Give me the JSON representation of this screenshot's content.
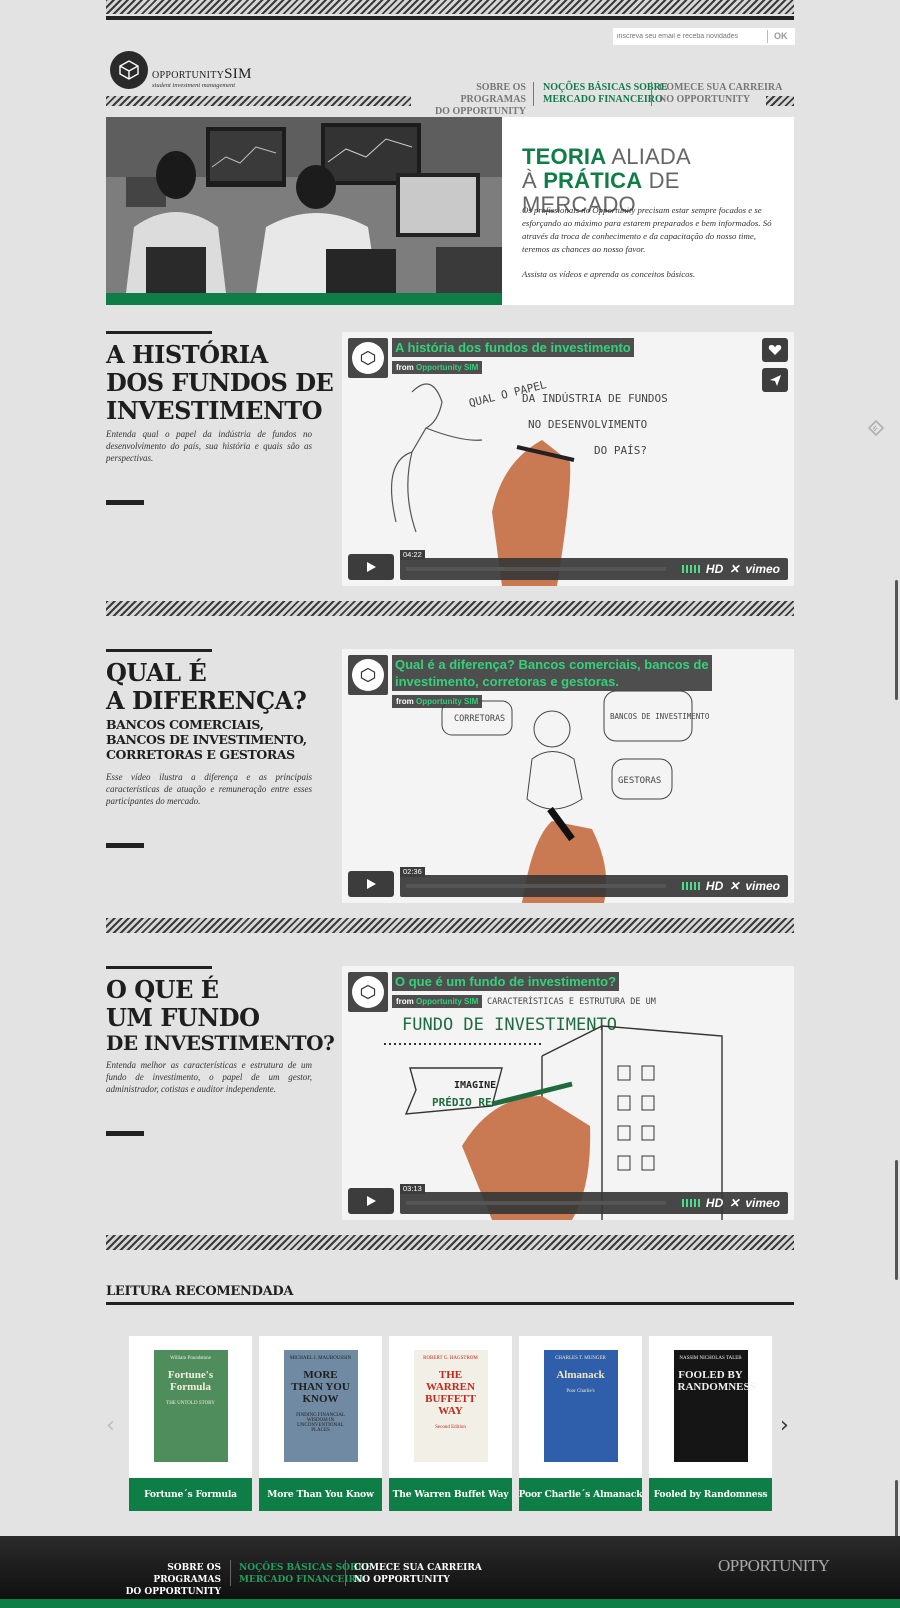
{
  "newsletter": {
    "placeholder": "inscreva seu email e receba novidades",
    "button": "OK"
  },
  "logo": {
    "name_prefix": "OPPORTUNITY",
    "name_suffix": "SIM",
    "tagline": "student investment management"
  },
  "nav": [
    {
      "line1": "SOBRE OS PROGRAMAS",
      "line2": "DO OPPORTUNITY"
    },
    {
      "line1": "NOÇÕES BÁSICAS SOBRE",
      "line2": "MERCADO FINANCEIRO"
    },
    {
      "line1": "COMECE SUA CARREIRA",
      "line2": "NO OPPORTUNITY"
    }
  ],
  "hero": {
    "title_a_bold": "TEORIA",
    "title_a_light": " ALIADA",
    "title_b_light": "À ",
    "title_b_bold": "PRÁTICA",
    "title_b_end": " DE MERCADO",
    "text": "Os profissionais no Opportunity precisam estar sempre focados e se esforçando ao máximo para estarem preparados e bem informados. Só através da troca de conhecimento e da capacitação do nosso time, teremos as chances ao nosso favor.",
    "text2": "Assista os vídeos e aprenda os conceitos básicos."
  },
  "sections": [
    {
      "title1": "A HISTÓRIA",
      "title2": "DOS FUNDOS DE",
      "title3": "INVESTIMENTO",
      "desc": "Entenda qual o papel da indústria de fundos no desenvolvimento do país, sua história e quais são as perspectivas.",
      "video_title": "A história dos fundos de investimento",
      "duration": "04:22",
      "board": [
        "QUAL O PAPEL",
        "DA INDÚSTRIA DE FUNDOS",
        "NO DESENVOLVIMENTO",
        "DO PAÍS?"
      ]
    },
    {
      "title1": "QUAL É",
      "title2": "A DIFERENÇA?",
      "sub1": "BANCOS COMERCIAIS,",
      "sub2": "BANCOS DE INVESTIMENTO,",
      "sub3": "CORRETORAS E GESTORAS",
      "desc": "Esse vídeo ilustra a diferença e as principais características de atuação e remuneração entre esses participantes do mercado.",
      "video_title1": "Qual é a diferença? Bancos comerciais, bancos de",
      "video_title2": "investimento, corretoras e gestoras.",
      "duration": "02:36",
      "board": [
        "CORRETORAS",
        "BANCOS DE INVESTIMENTO",
        "GESTORAS"
      ]
    },
    {
      "title1": "O QUE É",
      "title2": "UM FUNDO",
      "title3": "DE INVESTIMENTO?",
      "desc": "Entenda melhor as características e estrutura de um fundo de investimento, o papel de um gestor, administrador, cotistas e auditor independente.",
      "video_title": "O que é um fundo de investimento?",
      "duration": "03:13",
      "board": [
        "CARACTERÍSTICAS E ESTRUTURA DE UM",
        "FUNDO DE INVESTIMENTO",
        "IMAGINE",
        "PRÉDIO RE"
      ]
    }
  ],
  "video_common": {
    "from_label": "from",
    "from_name": "Opportunity SIM",
    "hd": "HD",
    "brand": "vimeo"
  },
  "reading": {
    "title": "LEITURA RECOMENDADA",
    "books": [
      {
        "label": "Fortune´s Formula",
        "cover_title": "Fortune's Formula",
        "cover_sub": "THE UNTOLD STORY",
        "cover_author": "William Poundstone",
        "bg": "#4f8d5d",
        "fg": "#f3efe0"
      },
      {
        "label": "More Than You Know",
        "cover_title": "MORE THAN YOU KNOW",
        "cover_sub": "FINDING FINANCIAL WISDOM IN UNCONVENTIONAL PLACES",
        "cover_author": "MICHAEL J. MAUBOUSSIN",
        "bg": "#6f8aa2",
        "fg": "#1e1e1e"
      },
      {
        "label": "The Warren Buffet Way",
        "cover_title": "THE WARREN BUFFETT WAY",
        "cover_sub": "Second Edition",
        "cover_author": "ROBERT G. HAGSTROM",
        "bg": "#f1efe6",
        "fg": "#c4281f"
      },
      {
        "label": "Poor Charlie´s Almanack",
        "cover_title": "Almanack",
        "cover_sub": "Poor Charlie's",
        "cover_author": "CHARLES T. MUNGER",
        "bg": "#2f5fab",
        "fg": "#f1e7c0"
      },
      {
        "label": "Fooled by Randomness",
        "cover_title": "FOOLED BY RANDOMNESS",
        "cover_sub": "",
        "cover_author": "NASSIM NICHOLAS TALEB",
        "bg": "#151515",
        "fg": "#f0f0f0"
      }
    ]
  },
  "footer": {
    "nav": [
      {
        "line1": "SOBRE OS PROGRAMAS",
        "line2": "DO OPPORTUNITY"
      },
      {
        "line1": "NOÇÕES BÁSICAS SOBRE",
        "line2": "MERCADO FINANCEIRO"
      },
      {
        "line1": "COMECE SUA CARREIRA",
        "line2": "NO OPPORTUNITY"
      }
    ],
    "logo": "OPPORTUNITY"
  },
  "colors": {
    "accent_green": "#0f7d46",
    "video_green": "#33d17a",
    "background": "#e3e3e3"
  }
}
